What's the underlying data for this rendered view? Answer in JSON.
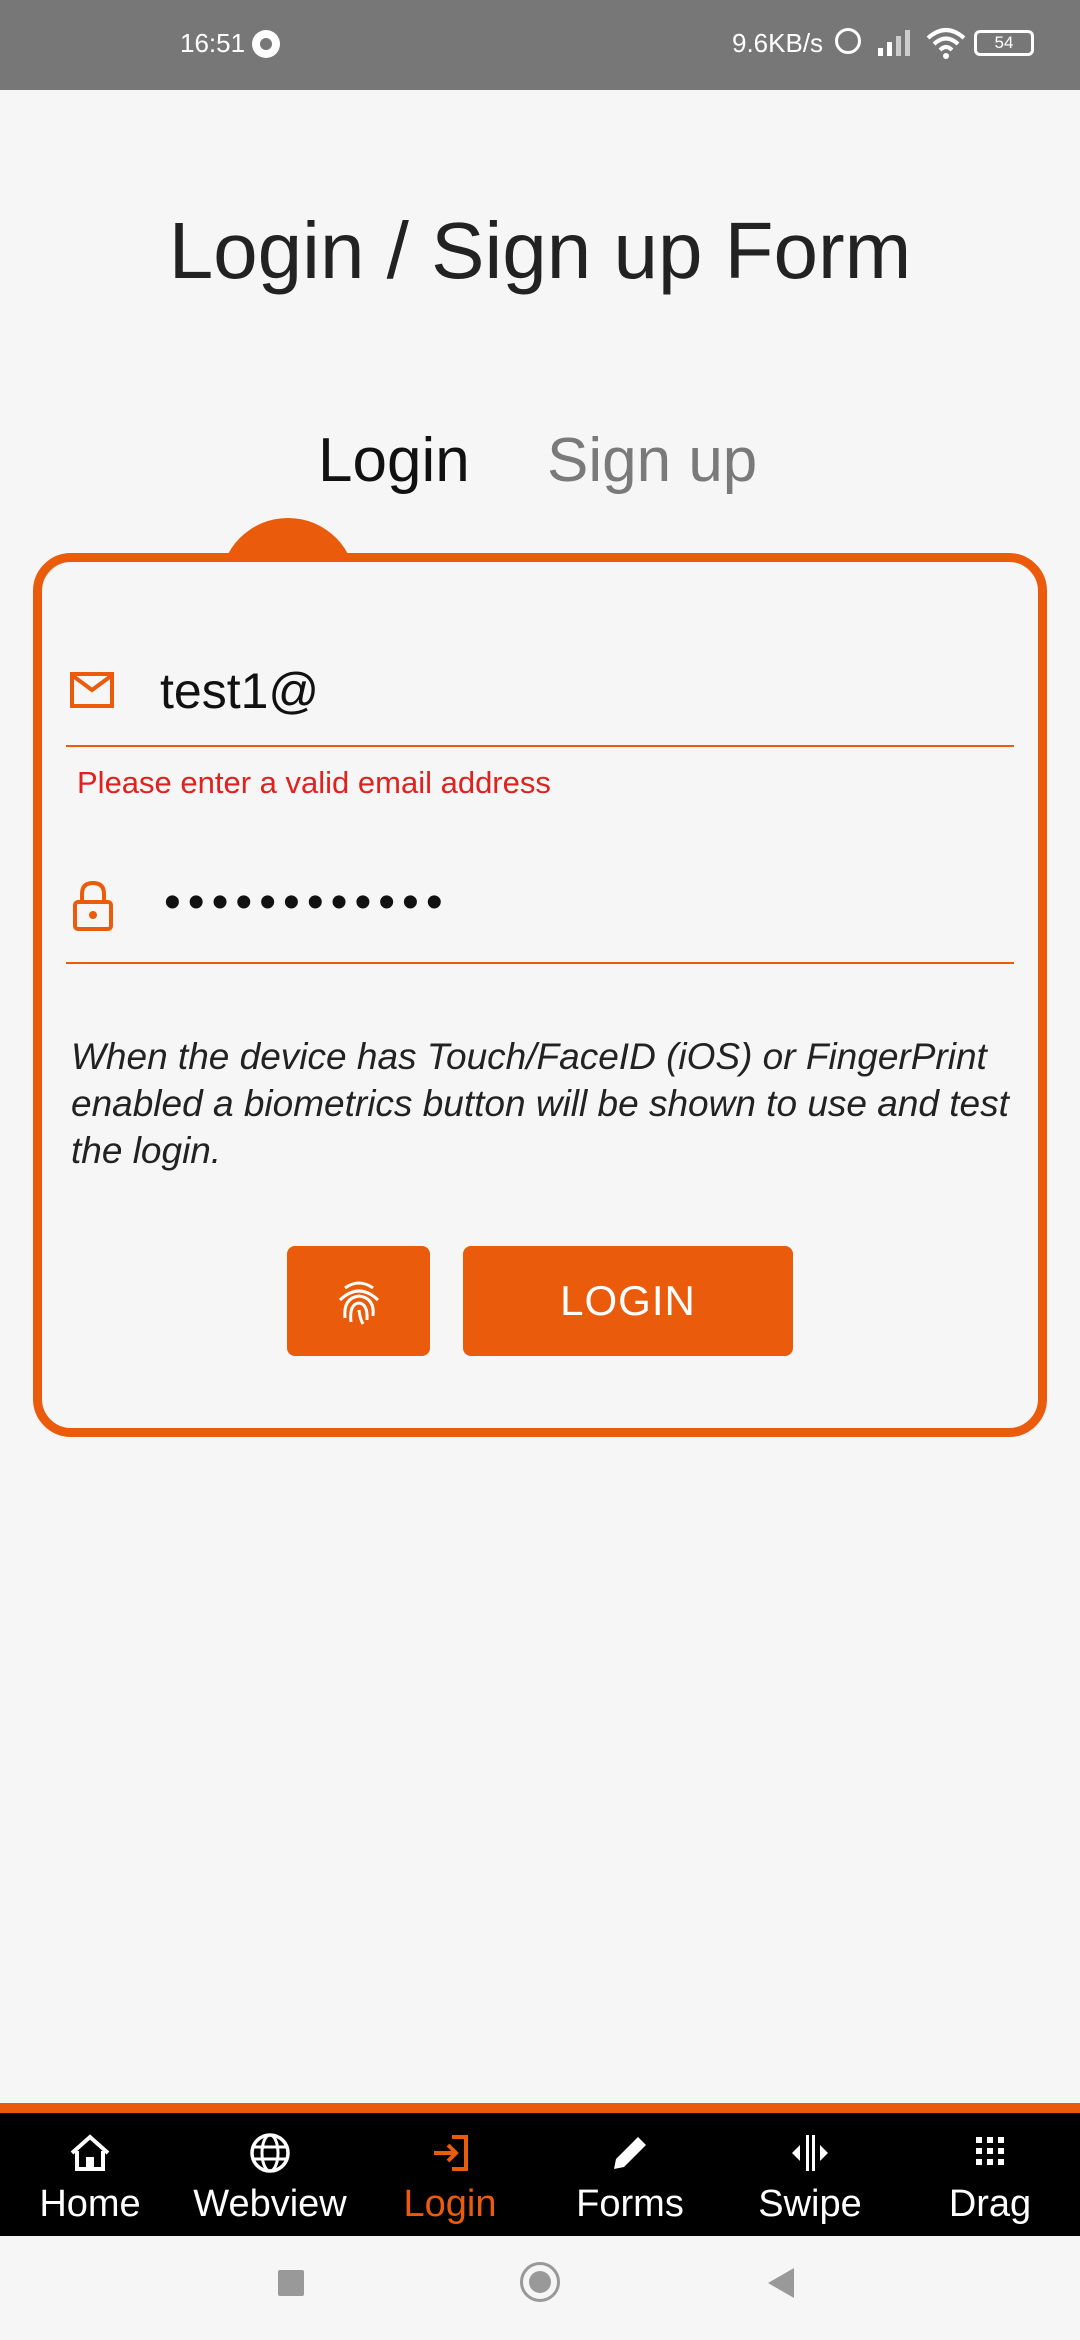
{
  "status_bar": {
    "time": "16:51",
    "network_speed": "9.6KB/s",
    "battery": "54",
    "icons": [
      "sync-icon",
      "alarm-icon",
      "signal-icon",
      "wifi-icon",
      "battery-icon"
    ]
  },
  "page": {
    "title": "Login / Sign up Form"
  },
  "tabs": {
    "login": "Login",
    "signup": "Sign up",
    "active": "login"
  },
  "form": {
    "email": {
      "icon": "mail-icon",
      "value": "test1@",
      "error": "Please enter a valid email address"
    },
    "password": {
      "icon": "lock-icon",
      "value": "••••••••••••"
    },
    "hint": "When the device has Touch/FaceID (iOS) or FingerPrint enabled a biometrics button will be shown to use and test the login.",
    "biometrics_icon": "fingerprint-icon",
    "login_button": "LOGIN"
  },
  "bottom_nav": {
    "items": [
      {
        "label": "Home",
        "icon": "home-icon"
      },
      {
        "label": "Webview",
        "icon": "globe-icon"
      },
      {
        "label": "Login",
        "icon": "login-icon"
      },
      {
        "label": "Forms",
        "icon": "pencil-icon"
      },
      {
        "label": "Swipe",
        "icon": "swipe-icon"
      },
      {
        "label": "Drag",
        "icon": "grid-icon"
      }
    ],
    "active": "Login"
  },
  "colors": {
    "accent": "#ea5b0c",
    "error": "#e0211d",
    "background": "#f6f6f6",
    "nav_background": "#000000"
  }
}
